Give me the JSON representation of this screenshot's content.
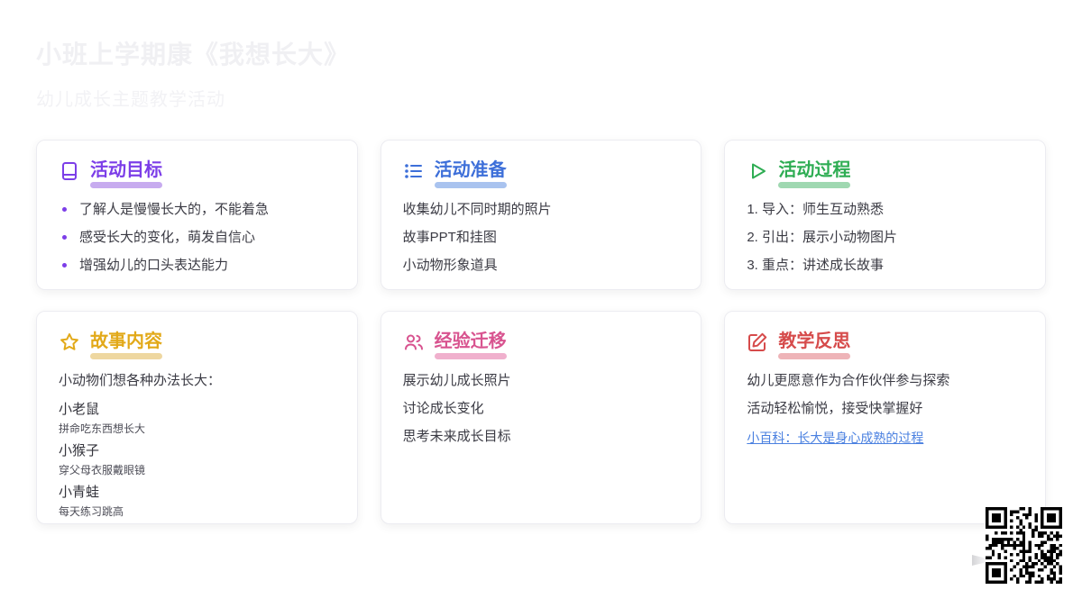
{
  "page": {
    "title": "小班上学期康《我想长大》",
    "subtitle": "幼儿成长主题教学活动"
  },
  "cards": [
    {
      "id": "goals",
      "icon": "book-icon",
      "title": "活动目标",
      "accent": "#7c3ee8",
      "accent_light": "#c7abef",
      "list_style": "bullet",
      "items": [
        "了解人是慢慢长大的，不能着急",
        "感受长大的变化，萌发自信心",
        "增强幼儿的口头表达能力"
      ]
    },
    {
      "id": "preparation",
      "icon": "list-icon",
      "title": "活动准备",
      "accent": "#3d6fd9",
      "accent_light": "#a9c3ef",
      "list_style": "plain",
      "items": [
        "收集幼儿不同时期的照片",
        "故事PPT和挂图",
        "小动物形象道具"
      ]
    },
    {
      "id": "process",
      "icon": "play-icon",
      "title": "活动过程",
      "accent": "#2ead53",
      "accent_light": "#9fd8b1",
      "list_style": "plain",
      "items": [
        "1. 导入：师生互动熟悉",
        "2. 引出：展示小动物图片",
        "3. 重点：讲述成长故事"
      ]
    },
    {
      "id": "story",
      "icon": "star-icon",
      "title": "故事内容",
      "accent": "#e2a919",
      "accent_light": "#eed7a0",
      "intro": "小动物们想各种办法长大：",
      "groups": [
        {
          "name": "小老鼠",
          "desc": "拼命吃东西想长大"
        },
        {
          "name": "小猴子",
          "desc": "穿父母衣服戴眼镜"
        },
        {
          "name": "小青蛙",
          "desc": "每天练习跳高"
        }
      ]
    },
    {
      "id": "transfer",
      "icon": "users-icon",
      "title": "经验迁移",
      "accent": "#d8538f",
      "accent_light": "#f0b0cd",
      "list_style": "plain",
      "items": [
        "展示幼儿成长照片",
        "讨论成长变化",
        "思考未来成长目标"
      ]
    },
    {
      "id": "reflection",
      "icon": "edit-icon",
      "title": "教学反思",
      "accent": "#d64b4b",
      "accent_light": "#eeb4b8",
      "list_style": "plain",
      "items": [
        "幼儿更愿意作为合作伙伴参与探索",
        "活动轻松愉悦，接受快掌握好"
      ],
      "link": {
        "text": "小百科：长大是身心成熟的过程",
        "color": "#4a80e0"
      }
    }
  ],
  "qr_code": {
    "name": "qr-code"
  }
}
